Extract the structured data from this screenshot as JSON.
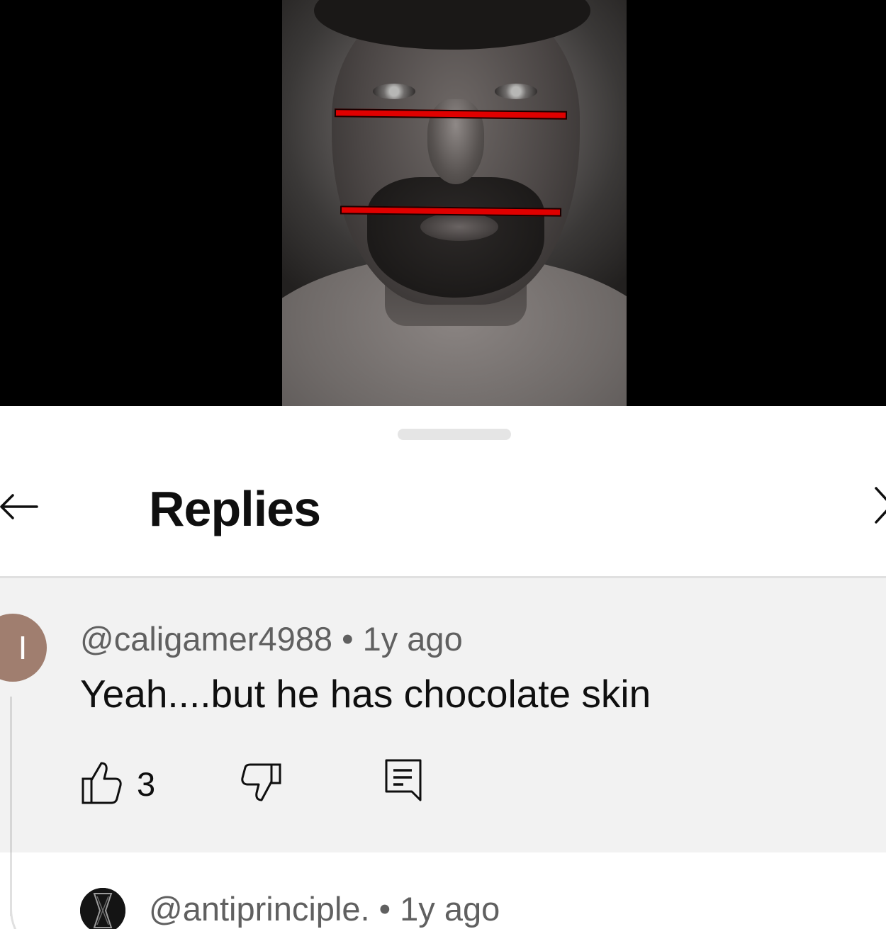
{
  "video": {
    "overlay_color": "#e00000"
  },
  "panel": {
    "title": "Replies",
    "back_icon": "arrow-left-icon",
    "close_icon": "close-icon"
  },
  "comment": {
    "avatar_letter": "I",
    "avatar_color": "#a07e6f",
    "handle": "@caligamer4988",
    "separator": " • ",
    "age": "1y ago",
    "text": "Yeah....but he has chocolate skin",
    "like_count": "3",
    "like_icon": "thumbs-up-icon",
    "dislike_icon": "thumbs-down-icon",
    "reply_icon": "comment-icon"
  },
  "reply": {
    "handle": "@antiprinciple.",
    "separator": " • ",
    "age": "1y ago"
  }
}
